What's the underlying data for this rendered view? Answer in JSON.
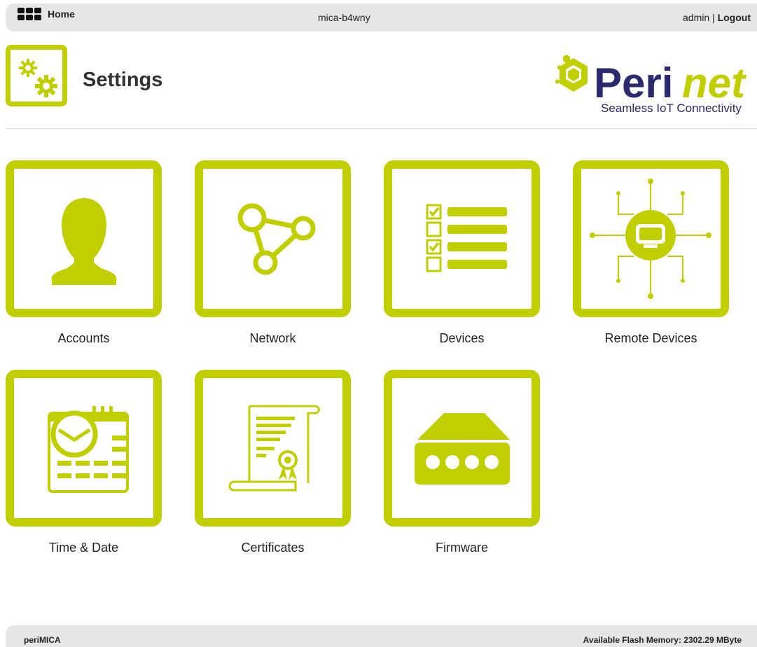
{
  "topbar": {
    "home_label": "Home",
    "hostname": "mica-b4wny",
    "user": "admin",
    "separator": "|",
    "logout_label": "Logout"
  },
  "header": {
    "title": "Settings",
    "icon": "gears-icon"
  },
  "logo": {
    "brand": "Perinet",
    "tagline": "Seamless IoT Connectivity"
  },
  "tiles": [
    {
      "label": "Accounts",
      "icon": "user-silhouette-icon"
    },
    {
      "label": "Network",
      "icon": "network-nodes-icon"
    },
    {
      "label": "Devices",
      "icon": "checklist-icon"
    },
    {
      "label": "Remote Devices",
      "icon": "remote-hub-icon"
    },
    {
      "label": "Time & Date",
      "icon": "calendar-clock-icon"
    },
    {
      "label": "Certificates",
      "icon": "certificate-icon"
    },
    {
      "label": "Firmware",
      "icon": "hardware-device-icon"
    }
  ],
  "footer": {
    "product": "periMICA",
    "flash_memory": "Available Flash Memory: 2302.29 MByte"
  },
  "colors": {
    "accent": "#c1cf00",
    "brand_navy": "#2a2a6e",
    "bar_bg": "#e6e6e6"
  }
}
